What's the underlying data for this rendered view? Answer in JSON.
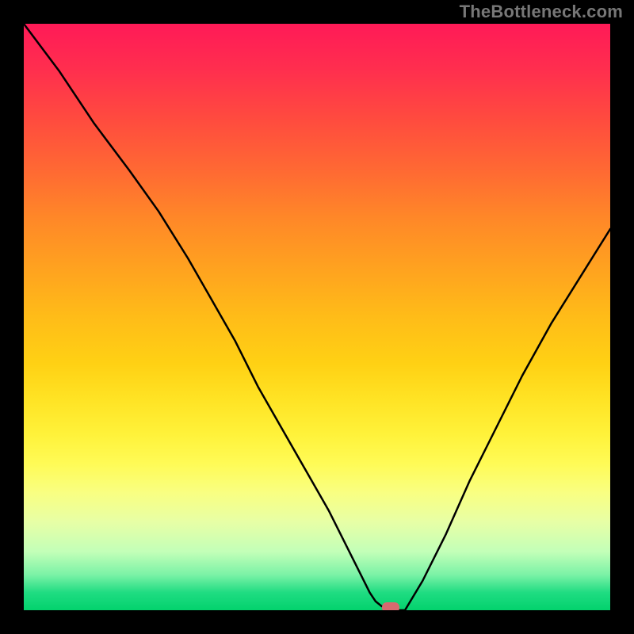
{
  "attribution": "TheBottleneck.com",
  "chart_data": {
    "type": "line",
    "title": "",
    "xlabel": "",
    "ylabel": "",
    "xlim": [
      0,
      100
    ],
    "ylim": [
      0,
      100
    ],
    "grid": false,
    "legend": false,
    "series": [
      {
        "name": "bottleneck-curve",
        "x": [
          0,
          6,
          12,
          18,
          23,
          28,
          32,
          36,
          40,
          44,
          48,
          52,
          55,
          57.5,
          59,
          60,
          61,
          62,
          63,
          65,
          68,
          72,
          76,
          80,
          85,
          90,
          95,
          100
        ],
        "values": [
          100,
          92,
          83,
          75,
          68,
          60,
          53,
          46,
          38,
          31,
          24,
          17,
          11,
          6,
          3,
          1.5,
          0.7,
          0.3,
          0,
          0,
          5,
          13,
          22,
          30,
          40,
          49,
          57,
          65
        ]
      }
    ],
    "marker": {
      "x": 62.5,
      "y": 0,
      "color": "#d66a6f"
    },
    "background_gradient": {
      "direction": "vertical",
      "stops": [
        {
          "pos": 0,
          "color": "#ff1a57"
        },
        {
          "pos": 25,
          "color": "#ff6933"
        },
        {
          "pos": 50,
          "color": "#ffbc18"
        },
        {
          "pos": 75,
          "color": "#fffb56"
        },
        {
          "pos": 90,
          "color": "#c3ffb8"
        },
        {
          "pos": 100,
          "color": "#03d26d"
        }
      ]
    }
  }
}
